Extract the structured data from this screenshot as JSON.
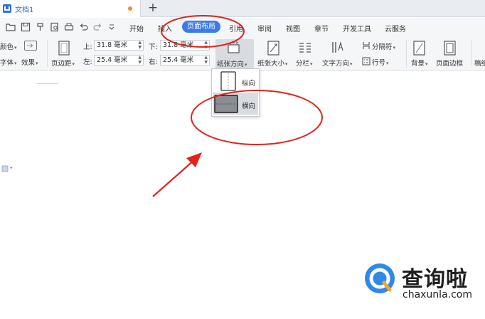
{
  "colors": {
    "accent": "#3d7be7",
    "annotation": "#e2231a",
    "doc_blue": "#2f6fdb",
    "unsaved": "#f08a3c"
  },
  "tab": {
    "title": "文档1",
    "new_tab": "+"
  },
  "quick_access_icons": [
    "open-folder-icon",
    "save-icon",
    "format-painter-icon",
    "print-preview-icon",
    "print-icon",
    "undo-icon",
    "redo-icon",
    "customize-icon"
  ],
  "menu": [
    "开始",
    "插入",
    "页面布局",
    "引用",
    "审阅",
    "视图",
    "章节",
    "开发工具",
    "云服务"
  ],
  "ribbon": {
    "color_label": "颜色",
    "font_label": "字体",
    "effects_label": "效果",
    "margins_label": "页边距",
    "margin_top_label": "上:",
    "margin_top_value": "31.8 毫米",
    "margin_left_label": "左:",
    "margin_left_value": "25.4 毫米",
    "margin_bottom_label": "下:",
    "margin_bottom_value": "31.8 毫米",
    "margin_right_label": "右:",
    "margin_right_value": "25.4 毫米",
    "orientation_label": "纸张方向",
    "size_label": "纸张大小",
    "columns_label": "分栏",
    "text_direction_label": "文字方向",
    "breaks_label": "分隔符",
    "line_numbers_label": "行号",
    "background_label": "背景",
    "page_border_label": "页面边框",
    "cut_label": "稿纸"
  },
  "orientation_menu": {
    "portrait": "纵向",
    "landscape": "横向"
  },
  "watermark": {
    "name": "查询啦",
    "domain": "chaxunla.com"
  }
}
